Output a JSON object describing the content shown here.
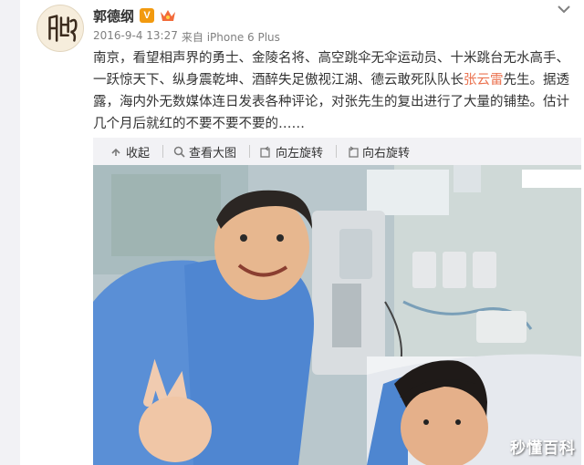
{
  "post": {
    "author": "郭德纲",
    "verified_badge": "V",
    "date": "2016-9-4 13:27",
    "source": "来自 iPhone 6 Plus",
    "text_before": "南京，看望相声界的勇士、金陵名将、高空跳伞无伞运动员、十米跳台无水高手、一跃惊天下、纵身震乾坤、酒醉失足傲视江湖、德云敢死队队长",
    "mention": "张云雷",
    "text_after": "先生。据透露，海内外无数媒体连日发表各种评论，对张先生的复出进行了大量的铺垫。估计几个月后就红的不要不要不要的……"
  },
  "toolbar": {
    "collapse": "收起",
    "view_large": "查看大图",
    "rotate_left": "向左旋转",
    "rotate_right": "向右旋转"
  },
  "watermark": "秒懂百科",
  "colors": {
    "mention": "#eb7350",
    "badge": "#f29a0f",
    "meta": "#808080",
    "toolbar_bg": "#f2f2f5"
  },
  "icons": [
    "avatar-logo-icon",
    "verified-icon",
    "member-icon",
    "chevron-down-icon",
    "collapse-icon",
    "zoom-icon",
    "rotate-left-icon",
    "rotate-right-icon"
  ]
}
